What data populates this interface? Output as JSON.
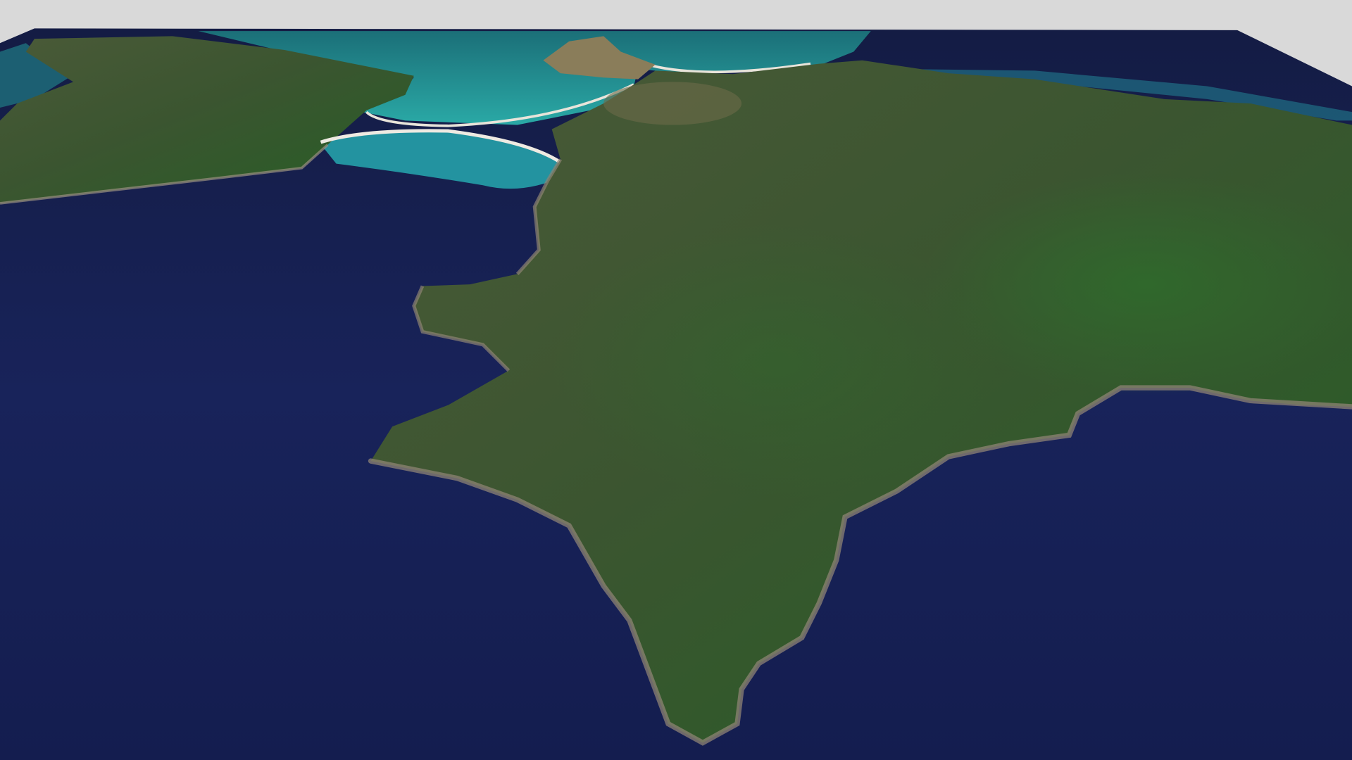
{
  "scene": {
    "kind": "3d-terrain-view",
    "colors": {
      "background": "#d9d9d9",
      "deep_ocean": "#131c48",
      "shallow_lagoon": "#1f9a9a",
      "forest": "#3a5a2a",
      "beach": "#e8e4da"
    }
  }
}
